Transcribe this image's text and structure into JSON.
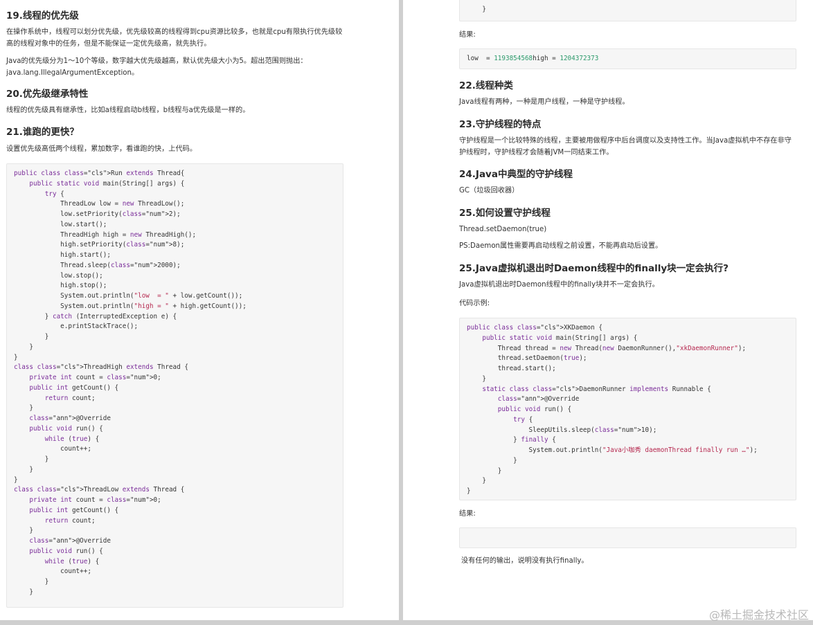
{
  "left": {
    "s19_title": "19.线程的优先级",
    "s19_p1": "在操作系统中，线程可以划分优先级，优先级较高的线程得到cpu资源比较多，也就是cpu有限执行优先级较高的线程对象中的任务，但是不能保证一定优先级高，就先执行。",
    "s19_p2": "Java的优先级分为1～10个等级，数字越大优先级越高，默认优先级大小为5。超出范围则抛出：java.lang.IllegalArgumentException。",
    "s20_title": "20.优先级继承特性",
    "s20_p1": "线程的优先级具有继承性，比如a线程启动b线程，b线程与a优先级是一样的。",
    "s21_title": "21.谁跑的更快？",
    "s21_p1": "设置优先级高低两个线程，累加数字，看谁跑的快，上代码。",
    "code": [
      "public class Run extends Thread{",
      "    public static void main(String[] args) {",
      "        try {",
      "            ThreadLow low = new ThreadLow();",
      "            low.setPriority(2);",
      "            low.start();",
      "            ThreadHigh high = new ThreadHigh();",
      "            high.setPriority(8);",
      "            high.start();",
      "            Thread.sleep(2000);",
      "            low.stop();",
      "            high.stop();",
      "            System.out.println(\"low  = \" + low.getCount());",
      "            System.out.println(\"high = \" + high.getCount());",
      "        } catch (InterruptedException e) {",
      "            e.printStackTrace();",
      "        }",
      "    }",
      "}",
      "class ThreadHigh extends Thread {",
      "    private int count = 0;",
      "    public int getCount() {",
      "        return count;",
      "    }",
      "    @Override",
      "    public void run() {",
      "        while (true) {",
      "            count++;",
      "        }",
      "    }",
      "}",
      "class ThreadLow extends Thread {",
      "    private int count = 0;",
      "    public int getCount() {",
      "        return count;",
      "    }",
      "    @Override",
      "    public void run() {",
      "        while (true) {",
      "            count++;",
      "        }",
      "    }"
    ]
  },
  "right": {
    "code_tail": "    }",
    "result_label_1": "结果:",
    "result_output_1": "low  = 1193854568high = 1204372373",
    "s22_title": "22.线程种类",
    "s22_p1": "Java线程有两种，一种是用户线程，一种是守护线程。",
    "s23_title": "23.守护线程的特点",
    "s23_p1": "守护线程是一个比较特殊的线程，主要被用做程序中后台调度以及支持性工作。当Java虚拟机中不存在非守护线程时，守护线程才会随着JVM一同结束工作。",
    "s24_title": "24.Java中典型的守护线程",
    "s24_p1": "GC（垃圾回收器）",
    "s25_title": "25.如何设置守护线程",
    "s25_p1": "Thread.setDaemon(true)",
    "s25_p2": "PS:Daemon属性需要再启动线程之前设置，不能再启动后设置。",
    "s25b_title": "25.Java虚拟机退出时Daemon线程中的finally块一定会执行?",
    "s25b_p1": "Java虚拟机退出时Daemon线程中的finally块并不一定会执行。",
    "s25b_p2": "代码示例:",
    "code": [
      "public class XKDaemon {",
      "    public static void main(String[] args) {",
      "        Thread thread = new Thread(new DaemonRunner(),\"xkDaemonRunner\");",
      "        thread.setDaemon(true);",
      "        thread.start();",
      "    }",
      "    static class DaemonRunner implements Runnable {",
      "        @Override",
      "        public void run() {",
      "            try {",
      "                SleepUtils.sleep(10);",
      "            } finally {",
      "                System.out.println(\"Java小咖秀 daemonThread finally run …\");",
      "            }",
      "        }",
      "    }",
      "}"
    ],
    "result_label_2": "结果:",
    "result_output_2": "",
    "conclusion": "没有任何的输出，说明没有执行finally。"
  },
  "watermark": "@稀土掘金技术社区"
}
